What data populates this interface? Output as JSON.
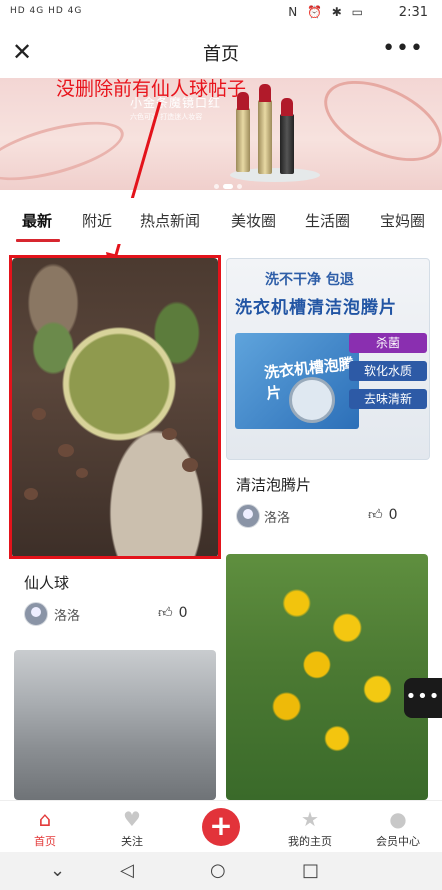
{
  "status": {
    "left_icons": "HD 4G HD 4G",
    "right_icons": "N ⏰ ✱ ▭",
    "time": "2:31"
  },
  "header": {
    "title": "首页",
    "close": "✕",
    "more": "•••"
  },
  "banner": {
    "brand": "小金条魔镜口红",
    "sub": "六色可选 打造迷人妆容"
  },
  "annotation": {
    "text": "没删除前有仙人球帖子"
  },
  "tabs": [
    "最新",
    "附近",
    "热点新闻",
    "美妆圈",
    "生活圈",
    "宝妈圈"
  ],
  "posts": [
    {
      "title": "仙人球",
      "author": "洛洛",
      "likes": "0"
    },
    {
      "title": "清洁泡腾片",
      "author": "洛洛",
      "likes": "0",
      "ad": {
        "headline": "洗不干净 包退",
        "product": "洗衣机槽清洁泡腾片",
        "box_text": "洗衣机槽泡腾片",
        "tags": [
          "杀菌",
          "软化水质",
          "去味清新"
        ]
      }
    }
  ],
  "float_button": "•••",
  "bottom_nav": [
    "首页",
    "关注",
    "+",
    "我的主页",
    "会员中心"
  ],
  "colors": {
    "accent": "#e33a3a",
    "annotation": "#e8141c"
  }
}
